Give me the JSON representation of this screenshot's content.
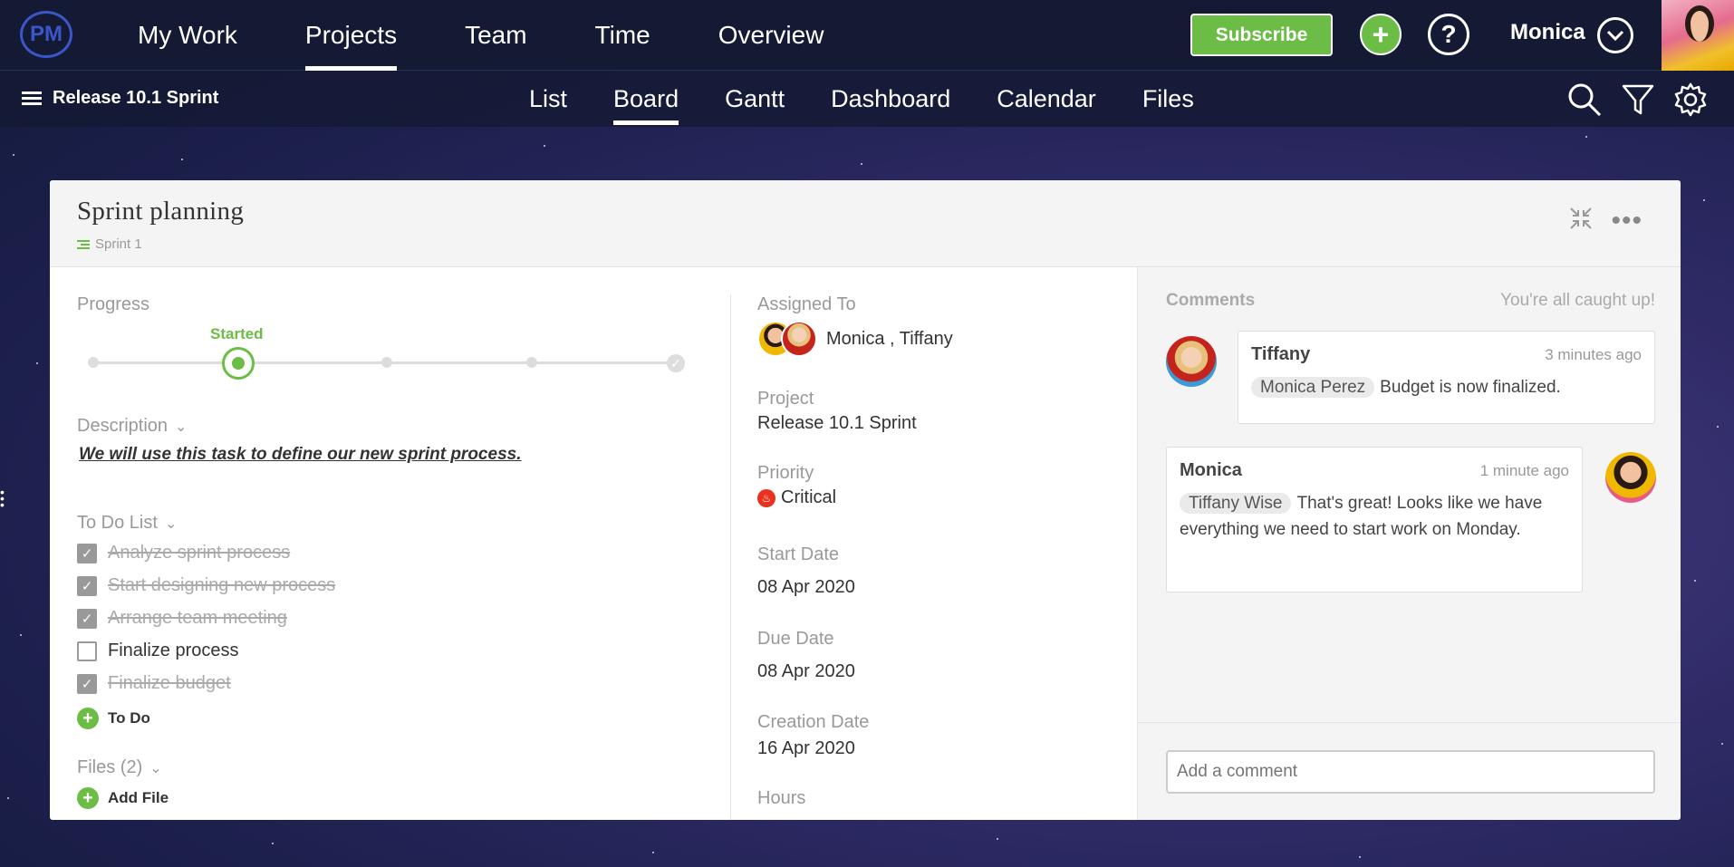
{
  "topnav": {
    "logo": "PM",
    "items": [
      "My Work",
      "Projects",
      "Team",
      "Time",
      "Overview"
    ],
    "active_index": 1,
    "subscribe_label": "Subscribe",
    "user_name": "Monica"
  },
  "subnav": {
    "project_name": "Release 10.1 Sprint",
    "items": [
      "List",
      "Board",
      "Gantt",
      "Dashboard",
      "Calendar",
      "Files"
    ],
    "active_index": 1
  },
  "task": {
    "title": "Sprint planning",
    "sprint": "Sprint 1",
    "progress_label": "Progress",
    "progress_status": "Started",
    "progress_step": 2,
    "progress_steps": 5,
    "description_label": "Description",
    "description": "We will use this task to define our new sprint process.",
    "todo_label": "To Do List",
    "todos": [
      {
        "text": "Analyze sprint process",
        "done": true
      },
      {
        "text": "Start designing new process",
        "done": true
      },
      {
        "text": "Arrange team meeting",
        "done": true
      },
      {
        "text": "Finalize process",
        "done": false
      },
      {
        "text": "Finalize budget",
        "done": true
      }
    ],
    "add_todo_label": "To Do",
    "files_label": "Files (2)",
    "add_file_label": "Add File"
  },
  "details": {
    "assigned_label": "Assigned To",
    "assigned_names": "Monica , Tiffany",
    "project_label": "Project",
    "project_value": "Release 10.1 Sprint",
    "priority_label": "Priority",
    "priority_value": "Critical",
    "start_label": "Start Date",
    "start_value": "08 Apr 2020",
    "due_label": "Due Date",
    "due_value": "08 Apr 2020",
    "creation_label": "Creation Date",
    "creation_value": "16 Apr 2020",
    "hours_label": "Hours"
  },
  "comments": {
    "title": "Comments",
    "status": "You're all caught up!",
    "items": [
      {
        "author": "Tiffany",
        "time": "3 minutes ago",
        "mention": "Monica  Perez",
        "text": "Budget is now finalized."
      },
      {
        "author": "Monica",
        "time": "1 minute ago",
        "mention": "Tiffany Wise",
        "text": "That's great! Looks like we have everything we need to start work on Monday."
      }
    ],
    "input_placeholder": "Add a comment"
  },
  "colors": {
    "accent_green": "#6cbd45",
    "navbar": "#141a33",
    "critical_red": "#e8311f"
  }
}
